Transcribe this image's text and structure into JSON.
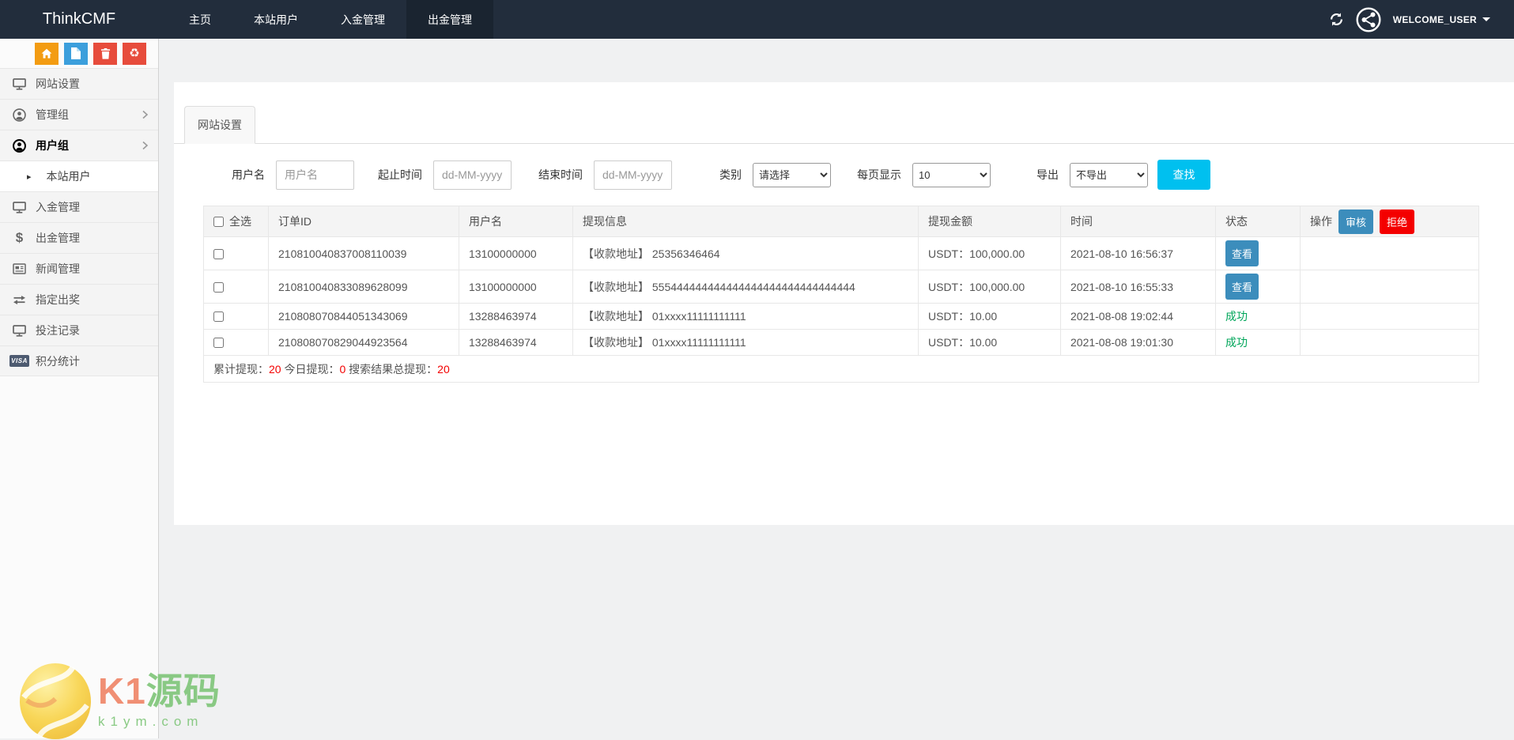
{
  "navbar": {
    "brand": "ThinkCMF",
    "items": [
      {
        "label": "主页"
      },
      {
        "label": "本站用户"
      },
      {
        "label": "入金管理"
      },
      {
        "label": "出金管理"
      }
    ],
    "user": "WELCOME_USER"
  },
  "sidebar": {
    "items": [
      {
        "label": "网站设置"
      },
      {
        "label": "管理组"
      },
      {
        "label": "用户组"
      },
      {
        "label": "本站用户"
      },
      {
        "label": "入金管理"
      },
      {
        "label": "出金管理"
      },
      {
        "label": "新闻管理"
      },
      {
        "label": "指定出奖"
      },
      {
        "label": "投注记录"
      },
      {
        "label": "积分统计"
      }
    ],
    "visa_icon_text": "VISA"
  },
  "tab": {
    "label": "网站设置"
  },
  "filters": {
    "username": {
      "label": "用户名",
      "placeholder": "用户名"
    },
    "start_time": {
      "label": "起止时间",
      "placeholder": "dd-MM-yyyy"
    },
    "end_time": {
      "label": "结束时间",
      "placeholder": "dd-MM-yyyy"
    },
    "category": {
      "label": "类别",
      "value": "请选择"
    },
    "page_size": {
      "label": "每页显示",
      "value": "10"
    },
    "export": {
      "label": "导出",
      "value": "不导出"
    },
    "search_label": "查找"
  },
  "table": {
    "select_all_label": "全选",
    "headers": [
      "订单ID",
      "用户名",
      "提现信息",
      "提现金额",
      "时间",
      "状态"
    ],
    "action_header": {
      "label": "操作",
      "approve": "审核",
      "reject": "拒绝"
    },
    "rows": [
      {
        "order_id": "210810040837008110039",
        "username": "13100000000",
        "info": "【收款地址】 25356346464",
        "amount": "USDT：100,000.00",
        "time": "2021-08-10 16:56:37",
        "status": "查看"
      },
      {
        "order_id": "210810040833089628099",
        "username": "13100000000",
        "info": "【收款地址】 555444444444444444444444444444444",
        "amount": "USDT：100,000.00",
        "time": "2021-08-10 16:55:33",
        "status": "查看"
      },
      {
        "order_id": "210808070844051343069",
        "username": "13288463974",
        "info": "【收款地址】 01xxxx11111111111",
        "amount": "USDT：10.00",
        "time": "2021-08-08 19:02:44",
        "status": "成功"
      },
      {
        "order_id": "210808070829044923564",
        "username": "13288463974",
        "info": "【收款地址】 01xxxx11111111111",
        "amount": "USDT：10.00",
        "time": "2021-08-08 19:01:30",
        "status": "成功"
      }
    ],
    "summary": {
      "total_label": "累计提现：",
      "total": "20",
      "today_label": "今日提现：",
      "today": "0",
      "search_label": "搜索结果总提现：",
      "search_total": "20"
    }
  },
  "watermark": {
    "text_k1": "K1",
    "text_cn": "源码",
    "domain": "k1ym.com"
  },
  "colors": {
    "navbar_bg": "#222d3c",
    "navbar_active_bg": "#1a2430",
    "search_button": "#00c0ef",
    "primary_button": "#3c8dbc",
    "reject_button": "#f40000",
    "success_text": "#00a65a",
    "quick_home": "#f39c12",
    "quick_file": "#3c9fdc",
    "quick_trash": "#e74c3c",
    "quick_recycle": "#e74c3c"
  }
}
